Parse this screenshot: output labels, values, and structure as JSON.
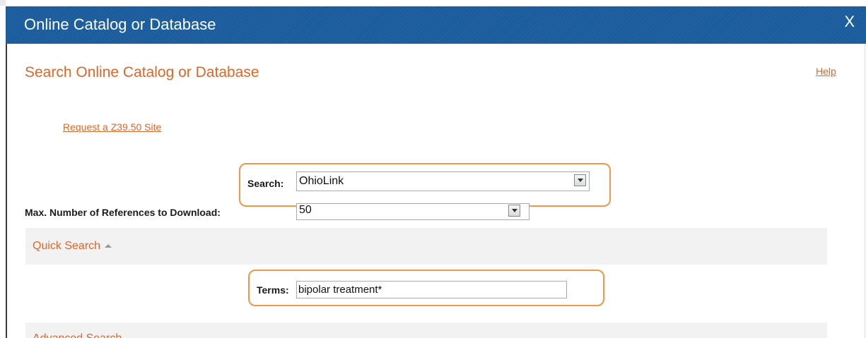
{
  "dialog": {
    "title": "Online Catalog or Database",
    "close_label": "X"
  },
  "page": {
    "heading": "Search Online Catalog or Database",
    "help_link": "Help",
    "request_link": "Request a Z39.50 Site"
  },
  "search": {
    "label": "Search:",
    "selected": "OhioLink"
  },
  "max_refs": {
    "label": "Max. Number of References to Download:",
    "selected": "50"
  },
  "quick_search": {
    "title": "Quick Search",
    "terms_label": "Terms:",
    "terms_value": "bipolar treatment*"
  },
  "advanced_search": {
    "title": "Advanced Search"
  },
  "colors": {
    "titlebar": "#1b5c9d",
    "accent": "#d8682b",
    "highlight": "#f0974a",
    "panel": "#f2f2f2"
  }
}
